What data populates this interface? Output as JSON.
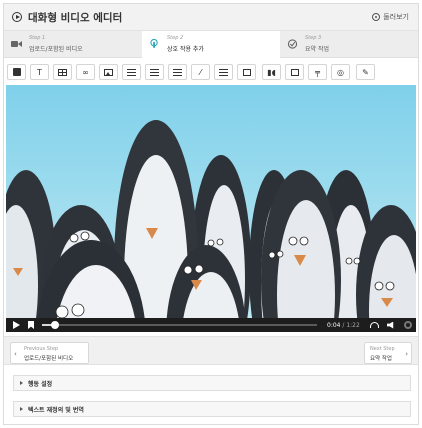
{
  "header": {
    "title": "대화형 비디오 에디터",
    "preview_label": "둘러보기"
  },
  "steps": [
    {
      "number": "Step 1",
      "label": "업로드/포함된 비디오",
      "icon": "video-camera-icon",
      "active": false
    },
    {
      "number": "Step 2",
      "label": "상호 작용 추가",
      "icon": "touch-icon",
      "active": true
    },
    {
      "number": "Step 3",
      "label": "요약 작업",
      "icon": "check-circle-icon",
      "active": false
    }
  ],
  "toolbar": {
    "items": [
      "label-icon",
      "text-icon",
      "table-icon",
      "link-icon",
      "image-icon",
      "statements-icon",
      "single-choice-icon",
      "multiple-choice-icon",
      "true-false-icon",
      "fill-blanks-icon",
      "drag-text-icon",
      "mark-words-icon",
      "drag-drop-icon",
      "crossroads-icon",
      "hotspot-icon",
      "free-text-icon"
    ]
  },
  "player": {
    "current_time": "0:04",
    "duration": "1:22",
    "progress_fraction": 0.049
  },
  "navigation": {
    "previous_small": "Previous Step",
    "previous_label": "업로드/포함된 비디오",
    "next_small": "Next Step",
    "next_label": "요약 작업"
  },
  "accordion": [
    {
      "label": "행동 설정"
    },
    {
      "label": "텍스트 재정의 및 번역"
    }
  ],
  "colors": {
    "header_bg": "#f2f2f2",
    "step_active_bg": "#ffffff",
    "step2_icon": "#2aa7b8",
    "controls_bg": "#1d1d1d",
    "sky": "#8fd6ea"
  }
}
